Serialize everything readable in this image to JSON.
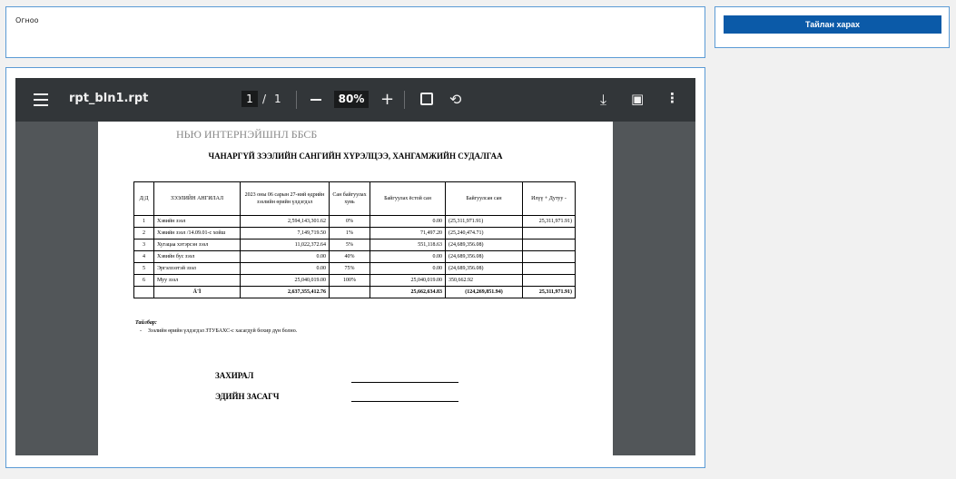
{
  "date_panel": {
    "label": "Огноо"
  },
  "actions": {
    "report_button": "Тайлан харах"
  },
  "viewer": {
    "file_name": "rpt_bln1.rpt",
    "page_current": "1",
    "page_sep": "/",
    "page_total": "1",
    "zoom": "80%"
  },
  "report": {
    "company": "НЬЮ ИНТЕРНЭЙШНЛ ББСБ",
    "title": "ЧАНАРГҮЙ ЗЭЭЛИЙН САНГИЙН ХҮРЭЛЦЭЭ, ХАНГАМЖИЙН СУДАЛГАА",
    "headers": [
      "Д/Д",
      "ЗЭЭЛИЙН АНГИЛАЛ",
      "2023 оны 06 сарын 27-ний өдрийн зээлийн өрийн үлдэгдэл",
      "Сан байгуулах хувь",
      "Байгуулах ёстой сан",
      "Байгуулсан сан",
      "Илүү + Дутуу -"
    ],
    "rows": [
      {
        "no": "1",
        "name": "Хэвийн зээл",
        "balance": "2,594,143,301.62",
        "pct": "0%",
        "required": "0.00",
        "created": "(25,311,971.91)",
        "diff": "25,311,971.91)"
      },
      {
        "no": "2",
        "name": "Хэвийн зээл /14.09.01-с хойш",
        "balance": "7,149,719.50",
        "pct": "1%",
        "required": "71,497.20",
        "created": "(25,240,474.71)",
        "diff": ""
      },
      {
        "no": "3",
        "name": "Хугацаа хэтэрсэн зээл",
        "balance": "11,022,372.64",
        "pct": "5%",
        "required": "551,118.63",
        "created": "(24,689,356.08)",
        "diff": ""
      },
      {
        "no": "4",
        "name": "Хэвийн бус зээл",
        "balance": "0.00",
        "pct": "40%",
        "required": "0.00",
        "created": "(24,689,356.08)",
        "diff": ""
      },
      {
        "no": "5",
        "name": "Эргэлзээтэй зээл",
        "balance": "0.00",
        "pct": "75%",
        "required": "0.00",
        "created": "(24,689,356.08)",
        "diff": ""
      },
      {
        "no": "6",
        "name": "Муу зээл",
        "balance": "25,040,019.00",
        "pct": "100%",
        "required": "25,040,019.00",
        "created": "350,662.92",
        "diff": ""
      }
    ],
    "total": {
      "label": "Ä¨Ï",
      "balance": "2,637,355,412.76",
      "pct": "",
      "required": "25,662,634.83",
      "created": "(124,269,851.94)",
      "diff": "25,311,971.91)"
    },
    "note_title": "Тайлбар:",
    "note_dash": "-",
    "note_text": "Зээлийн өрийн үлдэгдэл ЗТУБАХС-с хасагдуй бохир дүн болно.",
    "sign1": "ЗАХИРАЛ",
    "sign2": "ЭДИЙН ЗАСАГЧ"
  }
}
